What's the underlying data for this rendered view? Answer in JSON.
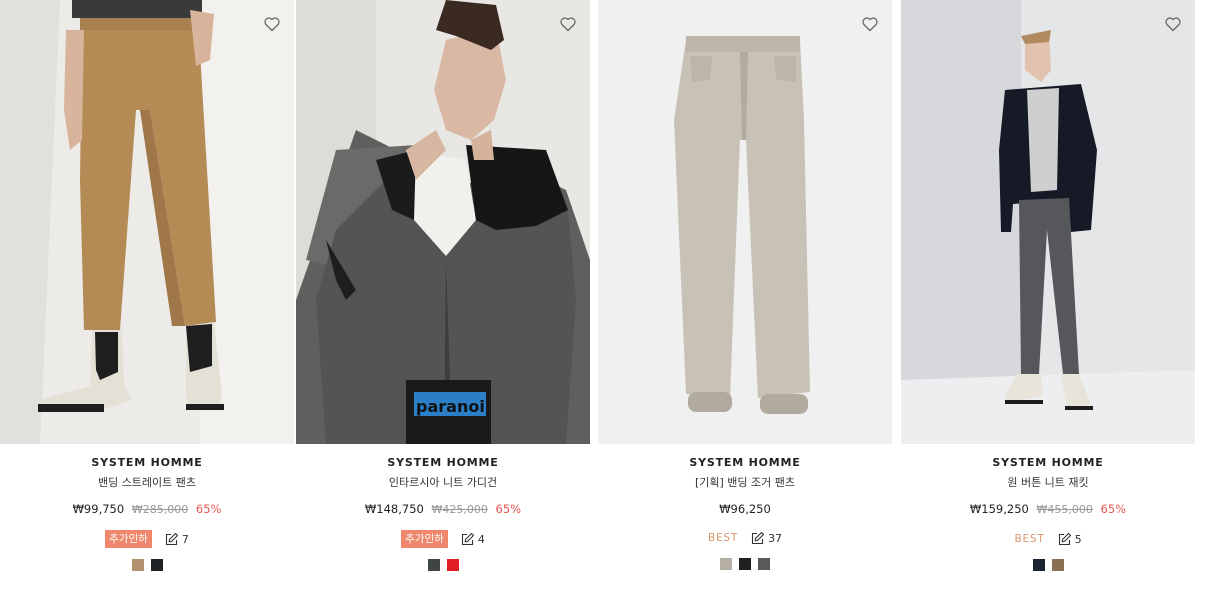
{
  "products": [
    {
      "brand": "SYSTEM HOMME",
      "name": "밴딩 스트레이트 팬츠",
      "price": "₩99,750",
      "original_price": "₩285,000",
      "discount": "65%",
      "badge": "추가인하",
      "badge_type": "coupon",
      "reviews": "7",
      "swatches": [
        "#b39270",
        "#1e2225"
      ],
      "icons": {
        "wish": "heart-outline-icon",
        "review": "edit-icon"
      }
    },
    {
      "brand": "SYSTEM HOMME",
      "name": "인타르시아 니트 가디건",
      "price": "₩148,750",
      "original_price": "₩425,000",
      "discount": "65%",
      "badge": "추가인하",
      "badge_type": "coupon",
      "reviews": "4",
      "swatches": [
        "#3f4540",
        "#e21f26"
      ],
      "icons": {
        "wish": "heart-outline-icon",
        "review": "edit-icon"
      }
    },
    {
      "brand": "SYSTEM HOMME",
      "name": "[기획] 밴딩 조거 팬츠",
      "price": "₩96,250",
      "original_price": "",
      "discount": "",
      "badge": "BEST",
      "badge_type": "best",
      "reviews": "37",
      "swatches": [
        "#b5aea3",
        "#1d1f20",
        "#57595a"
      ],
      "icons": {
        "wish": "heart-outline-icon",
        "review": "edit-icon"
      }
    },
    {
      "brand": "SYSTEM HOMME",
      "name": "원 버튼 니트 재킷",
      "price": "₩159,250",
      "original_price": "₩455,000",
      "discount": "65%",
      "badge": "BEST",
      "badge_type": "best",
      "reviews": "5",
      "swatches": [
        "#1b2433",
        "#8c7054"
      ],
      "icons": {
        "wish": "heart-outline-icon",
        "review": "edit-icon"
      }
    }
  ]
}
